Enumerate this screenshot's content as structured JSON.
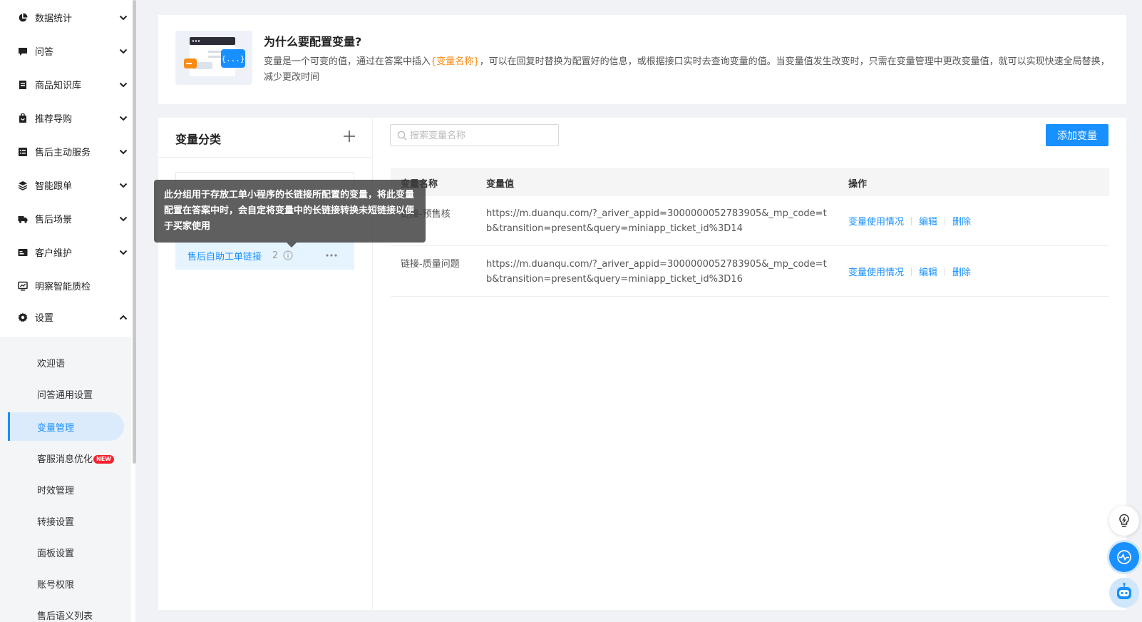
{
  "sidebar": {
    "menu": [
      {
        "label": "数据统计",
        "icon": "pie-chart-icon"
      },
      {
        "label": "问答",
        "icon": "chat-icon"
      },
      {
        "label": "商品知识库",
        "icon": "book-icon"
      },
      {
        "label": "推荐导购",
        "icon": "shopping-bag-icon"
      },
      {
        "label": "售后主动服务",
        "icon": "list-icon"
      },
      {
        "label": "智能跟单",
        "icon": "layers-icon"
      },
      {
        "label": "售后场景",
        "icon": "truck-icon"
      },
      {
        "label": "客户维护",
        "icon": "id-card-icon"
      },
      {
        "label": "明察智能质检",
        "icon": "monitor-icon"
      },
      {
        "label": "设置",
        "icon": "gear-icon"
      }
    ],
    "submenu": [
      {
        "label": "欢迎语"
      },
      {
        "label": "问答通用设置"
      },
      {
        "label": "变量管理"
      },
      {
        "label": "客服消息优化",
        "badge": "NEW"
      },
      {
        "label": "时效管理"
      },
      {
        "label": "转接设置"
      },
      {
        "label": "面板设置"
      },
      {
        "label": "账号权限"
      },
      {
        "label": "售后语义列表"
      }
    ]
  },
  "intro": {
    "title": "为什么要配置变量?",
    "desc_before": "变量是一个可变的值，通过在答案中插入",
    "desc_highlight": "{变量名称}",
    "desc_after": "，可以在回复时替换为配置好的信息，或根据接口实时去查询变量的值。当变量值发生改变时，只需在变量管理中更改变量值，就可以实现快速全局替换，减少更改时间"
  },
  "categories": {
    "title": "变量分类",
    "item": {
      "label": "售后自助工单链接",
      "count": "2"
    }
  },
  "tooltip": "此分组用于存放工单小程序的长链接所配置的变量，将此变量配置在答案中时，会自定将变量中的长链接转换未短链接以便于买家使用",
  "search": {
    "placeholder": "搜索变量名称"
  },
  "add_button": "添加变量",
  "table": {
    "headers": {
      "name": "变量名称",
      "value": "变量值",
      "ops": "操作"
    },
    "rows": [
      {
        "name": "链接-预售核",
        "value": "https://m.duanqu.com/?_ariver_appid=3000000052783905&_mp_code=tb&transition=present&query=miniapp_ticket_id%3D14"
      },
      {
        "name": "链接-质量问题",
        "value": "https://m.duanqu.com/?_ariver_appid=3000000052783905&_mp_code=tb&transition=present&query=miniapp_ticket_id%3D16"
      }
    ],
    "ops": {
      "usage": "变量使用情况",
      "edit": "编辑",
      "delete": "删除"
    }
  },
  "colors": {
    "primary": "#1890ff",
    "highlight": "#fa8c16",
    "active_bg": "#dcebfb",
    "badge": "#f5222d"
  }
}
